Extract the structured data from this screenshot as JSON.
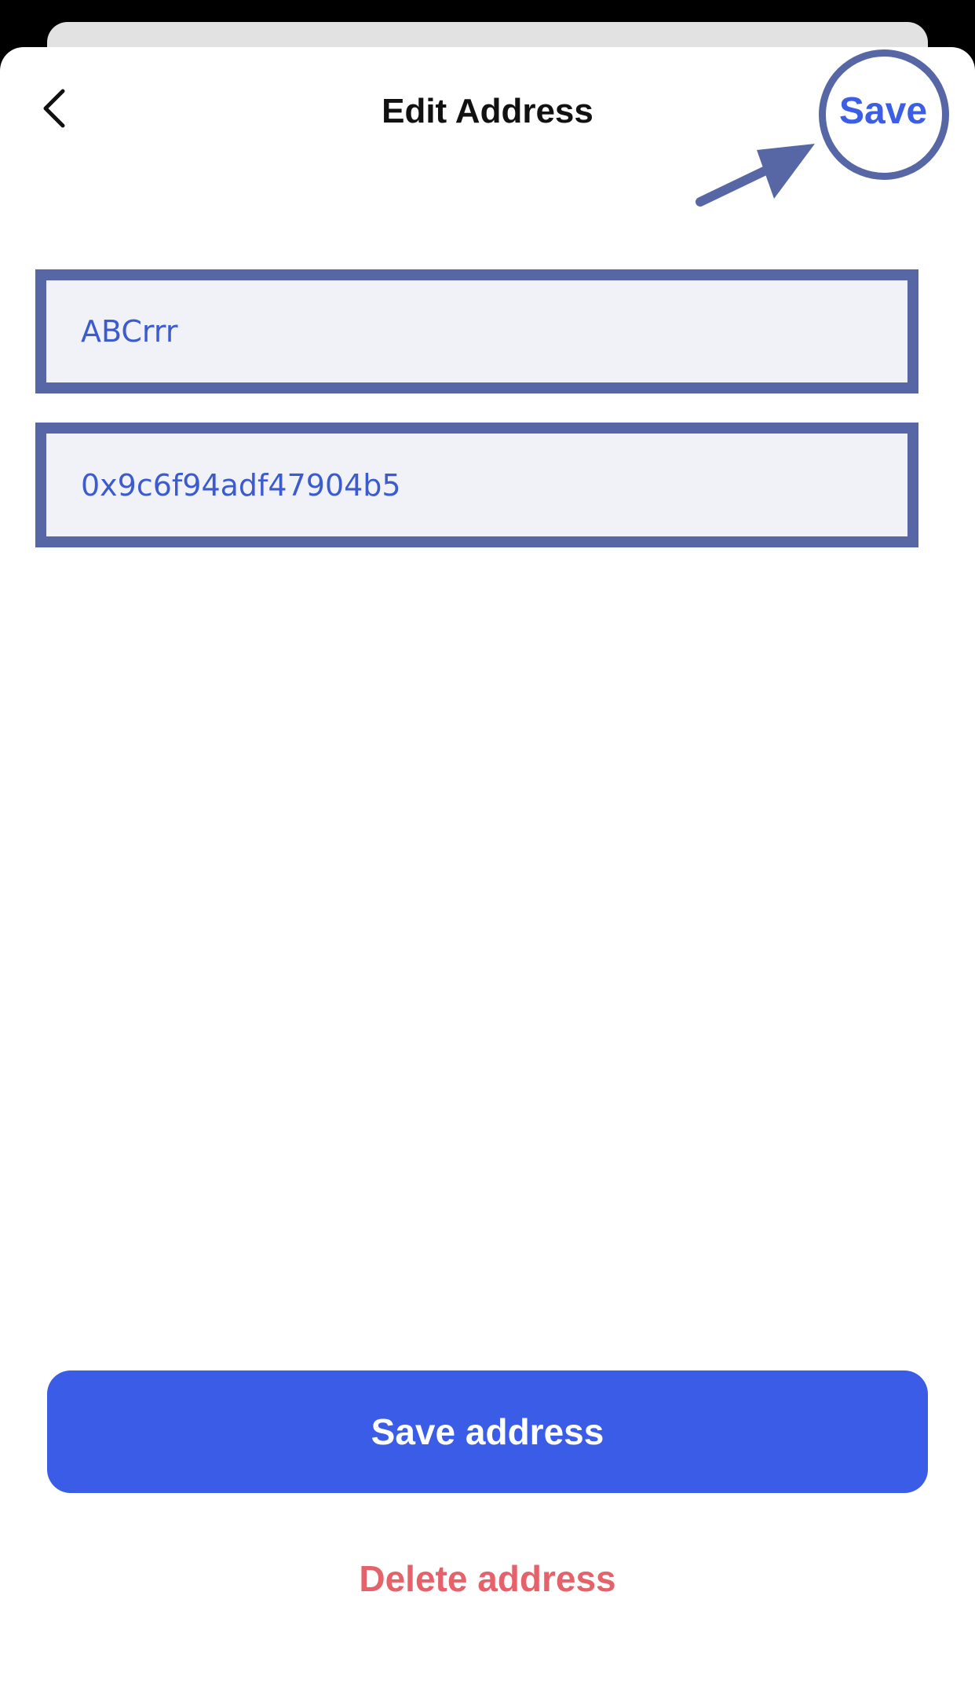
{
  "header": {
    "title": "Edit Address",
    "save_label": "Save",
    "back_icon": "chevron-left-icon"
  },
  "form": {
    "name_value": "ABCrrr",
    "address_value": "0x9c6f94adf47904b5"
  },
  "actions": {
    "save_address_label": "Save address",
    "delete_address_label": "Delete address"
  },
  "colors": {
    "accent": "#3a5ce7",
    "danger": "#e5626a",
    "annotation": "#5767a6",
    "field_bg": "#f1f2f7"
  }
}
